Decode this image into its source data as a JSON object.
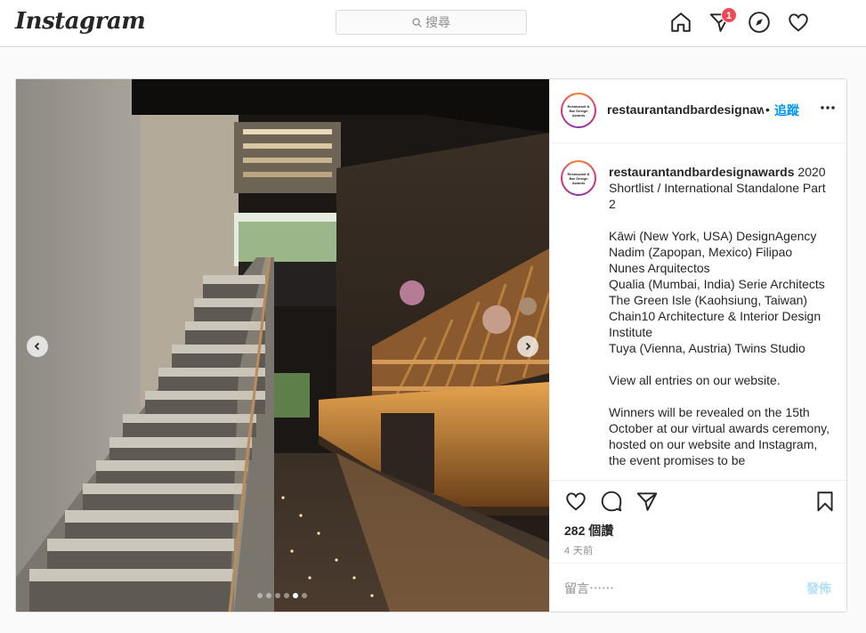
{
  "header": {
    "logo": "Instagram",
    "search_placeholder": "搜尋",
    "notification_count": "1"
  },
  "post": {
    "username": "restaurantandbardesignawards",
    "username_truncated": "restaurantandbardesignawa",
    "separator": "•",
    "follow_label": "追蹤",
    "avatar_text": "Restaurant & Bar Design Awards",
    "caption_user": "restaurantandbardesignawards",
    "caption_text": " 2020 Shortlist / International Standalone Part 2\n\nKāwi (New York, USA) DesignAgency\nNadim (Zapopan, Mexico) Filipao Nunes Arquitectos\nQualia (Mumbai, India) Serie Architects\nThe Green Isle (Kaohsiung, Taiwan) Chain10 Architecture & Interior Design Institute\nTuya (Vienna, Austria) Twins Studio\n\nView all entries on our website.\n\nWinners will be revealed on the 15th October at our virtual awards ceremony, hosted on our website and Instagram, the event promises to be",
    "views": "282 個讚",
    "time_ago": "4 天前",
    "comment_placeholder": "留言⋯⋯",
    "post_button": "發佈",
    "carousel": {
      "total": 6,
      "active_index": 4
    }
  },
  "icons": {
    "home": "home-icon",
    "direct": "paper-plane-icon",
    "explore": "compass-icon",
    "activity": "heart-icon",
    "like": "heart-outline-icon",
    "comment": "comment-icon",
    "share": "share-icon",
    "save": "bookmark-icon"
  },
  "colors": {
    "link_blue": "#0095f6",
    "badge_red": "#ed4956",
    "post_disabled": "#b2dffc"
  }
}
